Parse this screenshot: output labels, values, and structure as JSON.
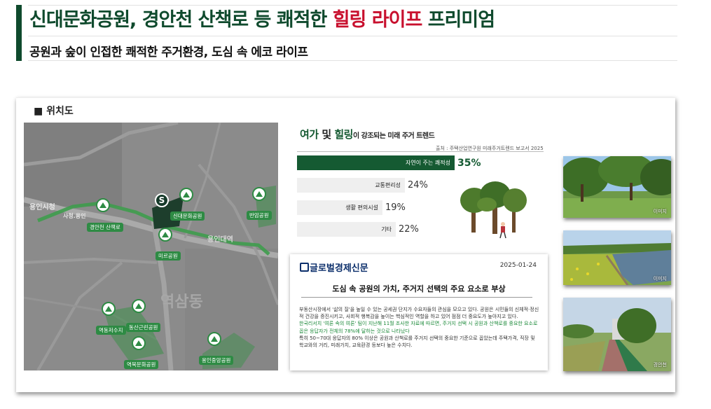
{
  "header": {
    "title_pre": "신대문화공원, 경안천 산책로 등 쾌적한 ",
    "title_highlight": "힐링 라이프",
    "title_post": " 프리미엄",
    "subtitle": "공원과 숲이 인접한 쾌적한 주거환경, 도심 속 에코 라이프"
  },
  "map": {
    "title": "■ 위치도",
    "area_labels": [
      "용인시청",
      "사청.용인",
      "용인대역",
      "역삼동"
    ],
    "pins": [
      {
        "label": "경안천 산책로"
      },
      {
        "label": "신대문화공원"
      },
      {
        "label": "미르공원"
      },
      {
        "label": "반암공원"
      },
      {
        "label": "역동저수지"
      },
      {
        "label": "동산근린공원"
      },
      {
        "label": "역북문화공원"
      },
      {
        "label": "용인중앙공원"
      }
    ],
    "site_marker": "S"
  },
  "trend": {
    "title_g1": "여가",
    "title_mid": " 및 ",
    "title_g2": "힐링",
    "title_rest": "이 강조되는 미래 주거 트렌드",
    "source": "출처 : 주택산업연구원 미래주거트렌드 보고서 2025",
    "items": [
      {
        "label": "자연이 주는 쾌적성",
        "value": 35,
        "display": "35%"
      },
      {
        "label": "교통편리성",
        "value": 24,
        "display": "24%"
      },
      {
        "label": "생활 편의시설",
        "value": 19,
        "display": "19%"
      },
      {
        "label": "기타",
        "value": 22,
        "display": "22%"
      }
    ]
  },
  "news": {
    "logo": "글로벌경제신문",
    "date": "2025-01-24",
    "headline": "도심 속 공원의 가치, 주거지 선택의 주요 요소로 부상",
    "para1": "부동산시장에서 '삶의 질'을 높일 수 있는 공세권 단지가 수요자들의 관심을 모으고 있다. 공원은 시민들의 신체적·정신적 건강을 증진시키고, 사회적 행복감을 높이는 핵심적인 역할을 하고 있어 점점 더 중요도가 높아지고 있다.",
    "para2": "한국리서치 '여론 속의 여론' 팀이 지난해 11월 조사한 자료에 따르면, 주거지 선택 시 공원과 산책로를 중요한 요소로 꼽은 응답자가 전체의 78%에 달하는 것으로 나타났다",
    "para3": "특히 50~70대 응답자의 80% 이상은 공원과 산책로를 주거지 선택의 중요한 기준으로 꼽았는데 주택가격, 직장 및 학교와의 거리, 미래가치, 교육환경 등보다 높은 수치다."
  },
  "photos": [
    {
      "caption": "이미지"
    },
    {
      "caption": "이미지"
    },
    {
      "caption": "경안천"
    }
  ]
}
